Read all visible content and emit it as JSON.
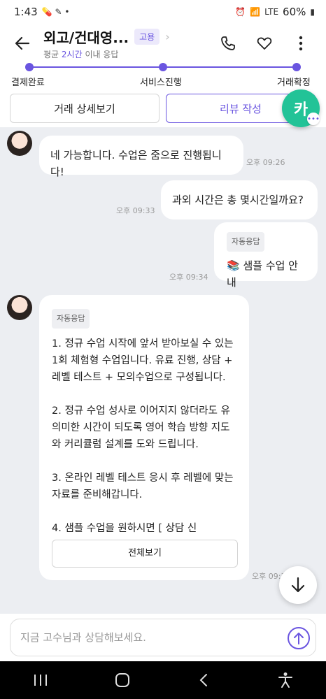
{
  "status_bar": {
    "time": "1:43",
    "battery": "60%",
    "network": "LTE"
  },
  "header": {
    "title": "외고/건대영...",
    "badge": "고용",
    "subtitle_prefix": "평균 ",
    "subtitle_highlight": "2시간",
    "subtitle_suffix": " 이내 응답"
  },
  "progress": {
    "steps": [
      "결제완료",
      "서비스진행",
      "거래확정"
    ]
  },
  "actions": {
    "detail_label": "거래 상세보기",
    "review_label": "리뷰 작성"
  },
  "kakao": {
    "label": "카"
  },
  "messages": [
    {
      "from": "other",
      "text": "네 가능합니다. 수업은 줌으로 진행됩니다!",
      "time": "오후 09:26"
    },
    {
      "from": "me",
      "text": "과외 시간은  총 몇시간일까요?",
      "time": "오후 09:33"
    },
    {
      "from": "other",
      "tag": "자동응답",
      "text": "📚 샘플 수업 안내",
      "time": "오후 09:34"
    },
    {
      "from": "other",
      "tag": "자동응답",
      "paragraphs": [
        "1. 정규 수업 시작에 앞서 받아보실 수 있는 1회 체험형 수업입니다. 유료 진행, 상담 + 레벨 테스트 + 모의수업으로 구성됩니다.",
        "2. 정규 수업 성사로 이어지지 않더라도 유의미한 시간이 되도록 영어 학습 방향 지도와 커리큘럼 설계를 도와 드립니다.",
        "3. 온라인 레벨 테스트 응시 후 레벨에 맞는 자료를 준비해갑니다.",
        "4. 샘플 수업을 원하시면 [ 상담 신"
      ],
      "button": "전체보기",
      "time": "오후 09:3"
    }
  ],
  "input": {
    "placeholder": "지금 고수님과 상담해보세요."
  },
  "colors": {
    "accent": "#6a55e0",
    "kakao": "#22c397",
    "chat_bg": "#eceef2"
  }
}
